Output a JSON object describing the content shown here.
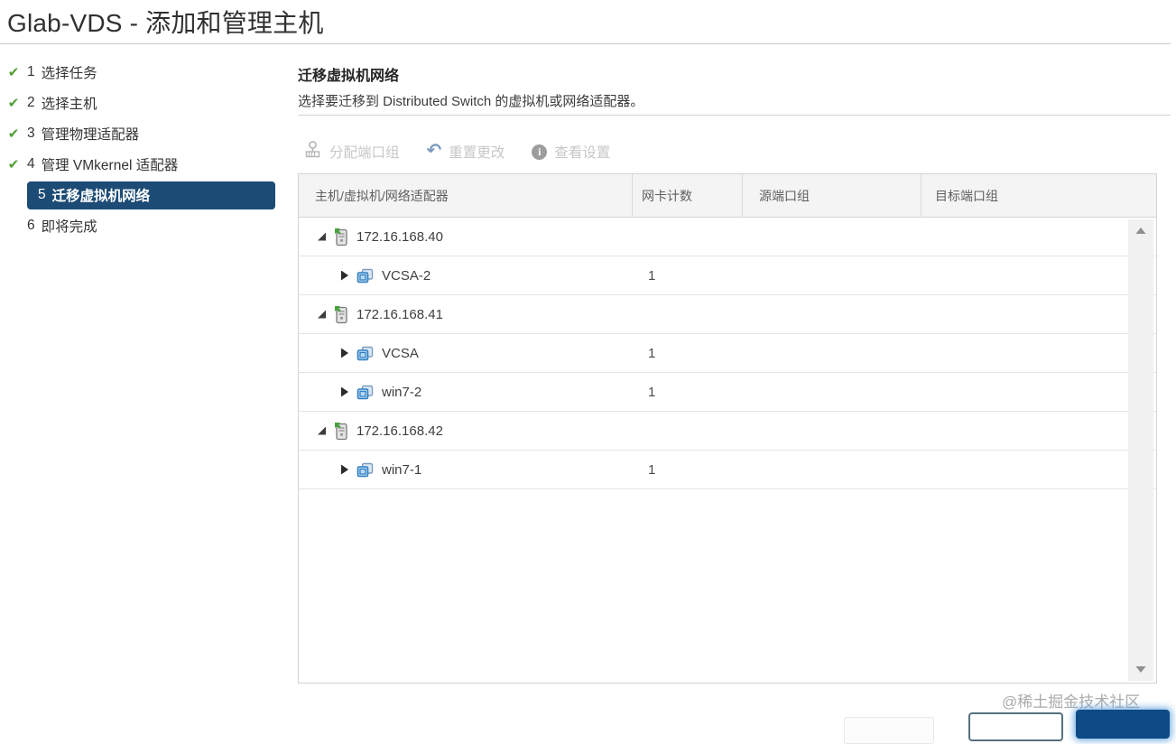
{
  "window": {
    "title": "Glab-VDS - 添加和管理主机"
  },
  "wizard": {
    "steps": [
      {
        "number": "1",
        "label": "选择任务",
        "completed": true,
        "active": false
      },
      {
        "number": "2",
        "label": "选择主机",
        "completed": true,
        "active": false
      },
      {
        "number": "3",
        "label": "管理物理适配器",
        "completed": true,
        "active": false
      },
      {
        "number": "4",
        "label": "管理 VMkernel 适配器",
        "completed": true,
        "active": false
      },
      {
        "number": "5",
        "label": "迁移虚拟机网络",
        "completed": false,
        "active": true
      },
      {
        "number": "6",
        "label": "即将完成",
        "completed": false,
        "active": false
      }
    ]
  },
  "content": {
    "heading": "迁移虚拟机网络",
    "description": "选择要迁移到 Distributed Switch 的虚拟机或网络适配器。",
    "toolbar": [
      {
        "label": "分配端口组",
        "icon": "assign-port-group-icon",
        "enabled": false
      },
      {
        "label": "重置更改",
        "icon": "undo-icon",
        "enabled": false
      },
      {
        "label": "查看设置",
        "icon": "info-icon",
        "enabled": false
      }
    ],
    "table": {
      "columns": [
        "主机/虚拟机/网络适配器",
        "网卡计数",
        "源端口组",
        "目标端口组"
      ],
      "rows": [
        {
          "type": "host",
          "name": "172.16.168.40",
          "expanded": true,
          "nic_count": ""
        },
        {
          "type": "vm",
          "name": "VCSA-2",
          "expanded": false,
          "nic_count": "1"
        },
        {
          "type": "host",
          "name": "172.16.168.41",
          "expanded": true,
          "nic_count": ""
        },
        {
          "type": "vm",
          "name": "VCSA",
          "expanded": false,
          "nic_count": "1"
        },
        {
          "type": "vm",
          "name": "win7-2",
          "expanded": false,
          "nic_count": "1"
        },
        {
          "type": "host",
          "name": "172.16.168.42",
          "expanded": true,
          "nic_count": ""
        },
        {
          "type": "vm",
          "name": "win7-1",
          "expanded": false,
          "nic_count": "1"
        }
      ]
    }
  },
  "footer": {
    "watermark": "@稀土掘金技术社区"
  },
  "colors": {
    "active_step_bg": "#1c4b75",
    "primary_button": "#0d4a86",
    "success_green": "#4f9e33",
    "vm_icon_blue": "#3e86c0",
    "disabled_text": "#c7c7c7"
  }
}
